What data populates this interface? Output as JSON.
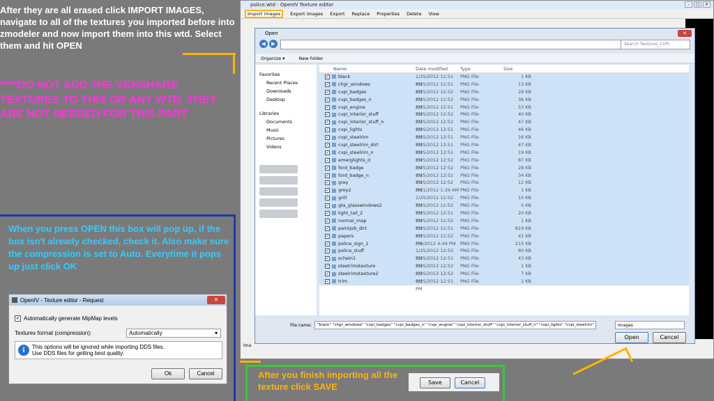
{
  "tutorial": {
    "step1": "After they are all erased click IMPORT IMAGES, navigate to all of the textures you imported before into zmodeler and now import them into this wtd. Select them and hit OPEN",
    "warning": "****DO NOT ADD THE VEHSHARE TEXTURES TO THIS OR ANY WTD. THEY ARE NOT NEEDED FOR THIS PART",
    "step2": "When you press OPEN this box will pop up, if the box isn't already checked, check it. Also make sure the compression is set to Auto. Everytime it pops up just click OK",
    "step3": "After you finish importing all the texture click SAVE"
  },
  "request_dialog": {
    "title": "OpenIV - Texture editor - Request",
    "mipmap_label": "Automatically generate MipMap levels",
    "format_label": "Textures format (compression):",
    "format_value": "Automatically",
    "info_text": "This options will be ignored while importing DDS files. Use DDS files for getting best quality.",
    "ok": "Ok",
    "cancel": "Cancel"
  },
  "app": {
    "title": "police.wtd - OpenIV Texture editor",
    "toolbar": [
      "Import images",
      "Export images",
      "Export",
      "Replace",
      "Properties",
      "Delete",
      "View"
    ],
    "status_prefix": "Ima"
  },
  "open_dialog": {
    "title": "Open",
    "search_placeholder": "Search Textures_CVPI",
    "organize": "Organize ▾",
    "new_folder": "New folder",
    "sidebar": {
      "favorites": "Favorites",
      "recent": "Recent Places",
      "downloads": "Downloads",
      "desktop": "Desktop",
      "libraries": "Libraries",
      "documents": "Documents",
      "music": "Music",
      "pictures": "Pictures",
      "videos": "Videos"
    },
    "columns": [
      "Name",
      "Date modified",
      "Type",
      "Size"
    ],
    "files": [
      [
        "black",
        "1/25/2012 12:51 PM",
        "PNG File",
        "1 KB"
      ],
      [
        "chgr_windows",
        "1/25/2012 12:51 PM",
        "PNG File",
        "13 KB"
      ],
      [
        "cvpi_badges",
        "1/25/2012 12:52 PM",
        "PNG File",
        "29 KB"
      ],
      [
        "cvpi_badges_n",
        "1/25/2012 12:52 PM",
        "PNG File",
        "36 KB"
      ],
      [
        "cvpi_engine",
        "1/25/2012 12:51 PM",
        "PNG File",
        "53 KB"
      ],
      [
        "cvpi_interior_stuff",
        "1/25/2012 12:52 PM",
        "PNG File",
        "40 KB"
      ],
      [
        "cvpi_interior_stuff_n",
        "1/25/2012 12:52 PM",
        "PNG File",
        "47 KB"
      ],
      [
        "cvpi_lights",
        "1/25/2012 12:51 PM",
        "PNG File",
        "46 KB"
      ],
      [
        "cvpi_steelrim",
        "1/25/2012 12:51 PM",
        "PNG File",
        "16 KB"
      ],
      [
        "cvpi_steelrim_dirt",
        "1/25/2012 12:51 PM",
        "PNG File",
        "47 KB"
      ],
      [
        "cvpi_steelrim_n",
        "1/25/2012 12:51 PM",
        "PNG File",
        "19 KB"
      ],
      [
        "emerglights_d",
        "1/25/2012 12:52 PM",
        "PNG File",
        "87 KB"
      ],
      [
        "ford_badge",
        "1/25/2012 12:52 PM",
        "PNG File",
        "28 KB"
      ],
      [
        "ford_badge_n",
        "1/25/2012 12:52 PM",
        "PNG File",
        "34 KB"
      ],
      [
        "grey",
        "1/25/2012 12:52 PM",
        "PNG File",
        "12 KB"
      ],
      [
        "grey2",
        "3/21/2012 1:29 AM",
        "PNG File",
        "1 KB"
      ],
      [
        "grill",
        "1/25/2012 12:52 PM",
        "PNG File",
        "10 KB"
      ],
      [
        "gta_glasswindows2",
        "1/25/2012 12:52 PM",
        "PNG File",
        "5 KB"
      ],
      [
        "light_tail_2",
        "1/25/2012 12:51 PM",
        "PNG File",
        "20 KB"
      ],
      [
        "normal_map",
        "1/25/2012 12:52 PM",
        "PNG File",
        "1 KB"
      ],
      [
        "paintjob_dirt",
        "1/25/2012 12:51 PM",
        "PNG File",
        "819 KB"
      ],
      [
        "papers",
        "1/25/2012 12:52 PM",
        "PNG File",
        "41 KB"
      ],
      [
        "police_sign_1",
        "7/6/2012 4:44 PM",
        "PNG File",
        "215 KB"
      ],
      [
        "police_stuff",
        "1/25/2012 12:52 PM",
        "PNG File",
        "80 KB"
      ],
      [
        "schein1",
        "1/25/2012 12:51 PM",
        "PNG File",
        "43 KB"
      ],
      [
        "steelrimstexture",
        "1/25/2012 12:52 PM",
        "PNG File",
        "1 KB"
      ],
      [
        "steelrimstexture2",
        "1/25/2012 12:52 PM",
        "PNG File",
        "7 KB"
      ],
      [
        "trim",
        "1/25/2012 12:51 PM",
        "PNG File",
        "1 KB"
      ]
    ],
    "filename_label": "File name:",
    "filename_value": "\"black\" \"chgr_windows\" \"cvpi_badges\" \"cvpi_badges_n\" \"cvpi_engine\" \"cvpi_interior_stuff\" \"cvpi_interior_stuff_n\" \"cvpi_lights\" \"cvpi_steelrim\"",
    "filetype": "Images",
    "open": "Open",
    "cancel": "Cancel"
  },
  "save_strip": {
    "save": "Save",
    "cancel": "Cancel"
  }
}
